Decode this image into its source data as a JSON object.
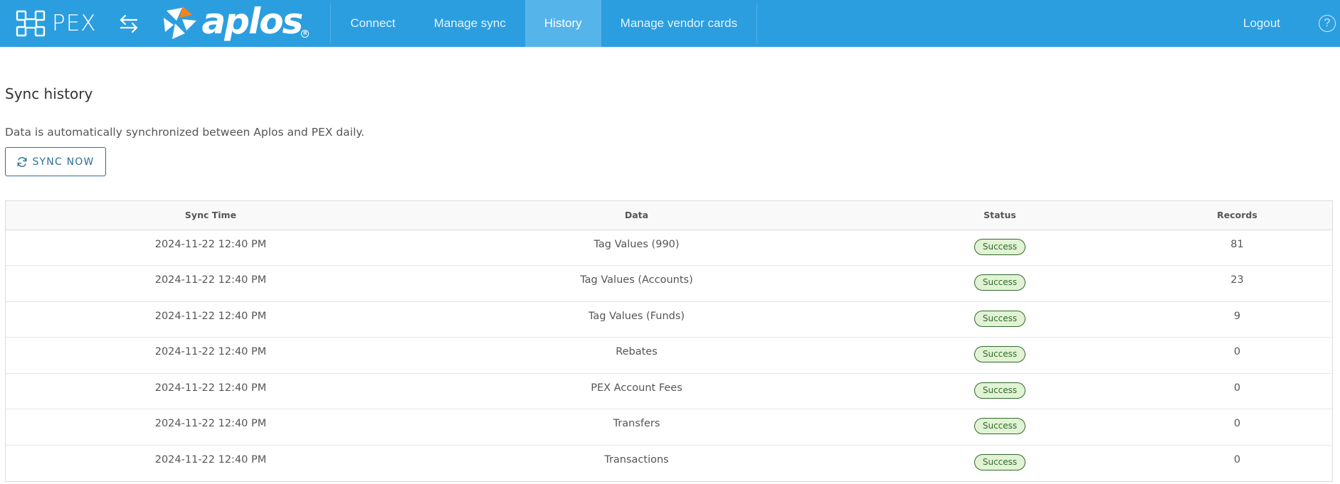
{
  "nav": {
    "brand_text": "PEX",
    "partner_text": "aplos",
    "links": [
      {
        "label": "Connect",
        "active": false
      },
      {
        "label": "Manage sync",
        "active": false
      },
      {
        "label": "History",
        "active": true
      },
      {
        "label": "Manage vendor cards",
        "active": false
      }
    ],
    "logout_label": "Logout",
    "help_symbol": "?"
  },
  "page": {
    "title": "Sync history",
    "description": "Data is automatically synchronized between Aplos and PEX daily.",
    "sync_button_label": "SYNC NOW"
  },
  "table": {
    "headers": [
      "Sync Time",
      "Data",
      "Status",
      "Records"
    ],
    "rows": [
      {
        "time": "2024-11-22 12:40 PM",
        "data": "Tag Values (990)",
        "status": "Success",
        "records": "81"
      },
      {
        "time": "2024-11-22 12:40 PM",
        "data": "Tag Values (Accounts)",
        "status": "Success",
        "records": "23"
      },
      {
        "time": "2024-11-22 12:40 PM",
        "data": "Tag Values (Funds)",
        "status": "Success",
        "records": "9"
      },
      {
        "time": "2024-11-22 12:40 PM",
        "data": "Rebates",
        "status": "Success",
        "records": "0"
      },
      {
        "time": "2024-11-22 12:40 PM",
        "data": "PEX Account Fees",
        "status": "Success",
        "records": "0"
      },
      {
        "time": "2024-11-22 12:40 PM",
        "data": "Transfers",
        "status": "Success",
        "records": "0"
      },
      {
        "time": "2024-11-22 12:40 PM",
        "data": "Transactions",
        "status": "Success",
        "records": "0"
      }
    ]
  },
  "colors": {
    "nav_background": "#2b9ee0",
    "nav_active": "#55b4ea",
    "aplos_accent": "#f5821f",
    "badge_background": "#e2f2d4",
    "badge_border": "#2f6b2a",
    "button_border": "#2a6f97"
  },
  "icons": {
    "pex_logo": "pex-grid-logo-icon",
    "swap": "swap-arrows-icon",
    "aplos_mark": "aplos-star-icon",
    "sync": "refresh-icon",
    "help": "help-circle-icon"
  }
}
